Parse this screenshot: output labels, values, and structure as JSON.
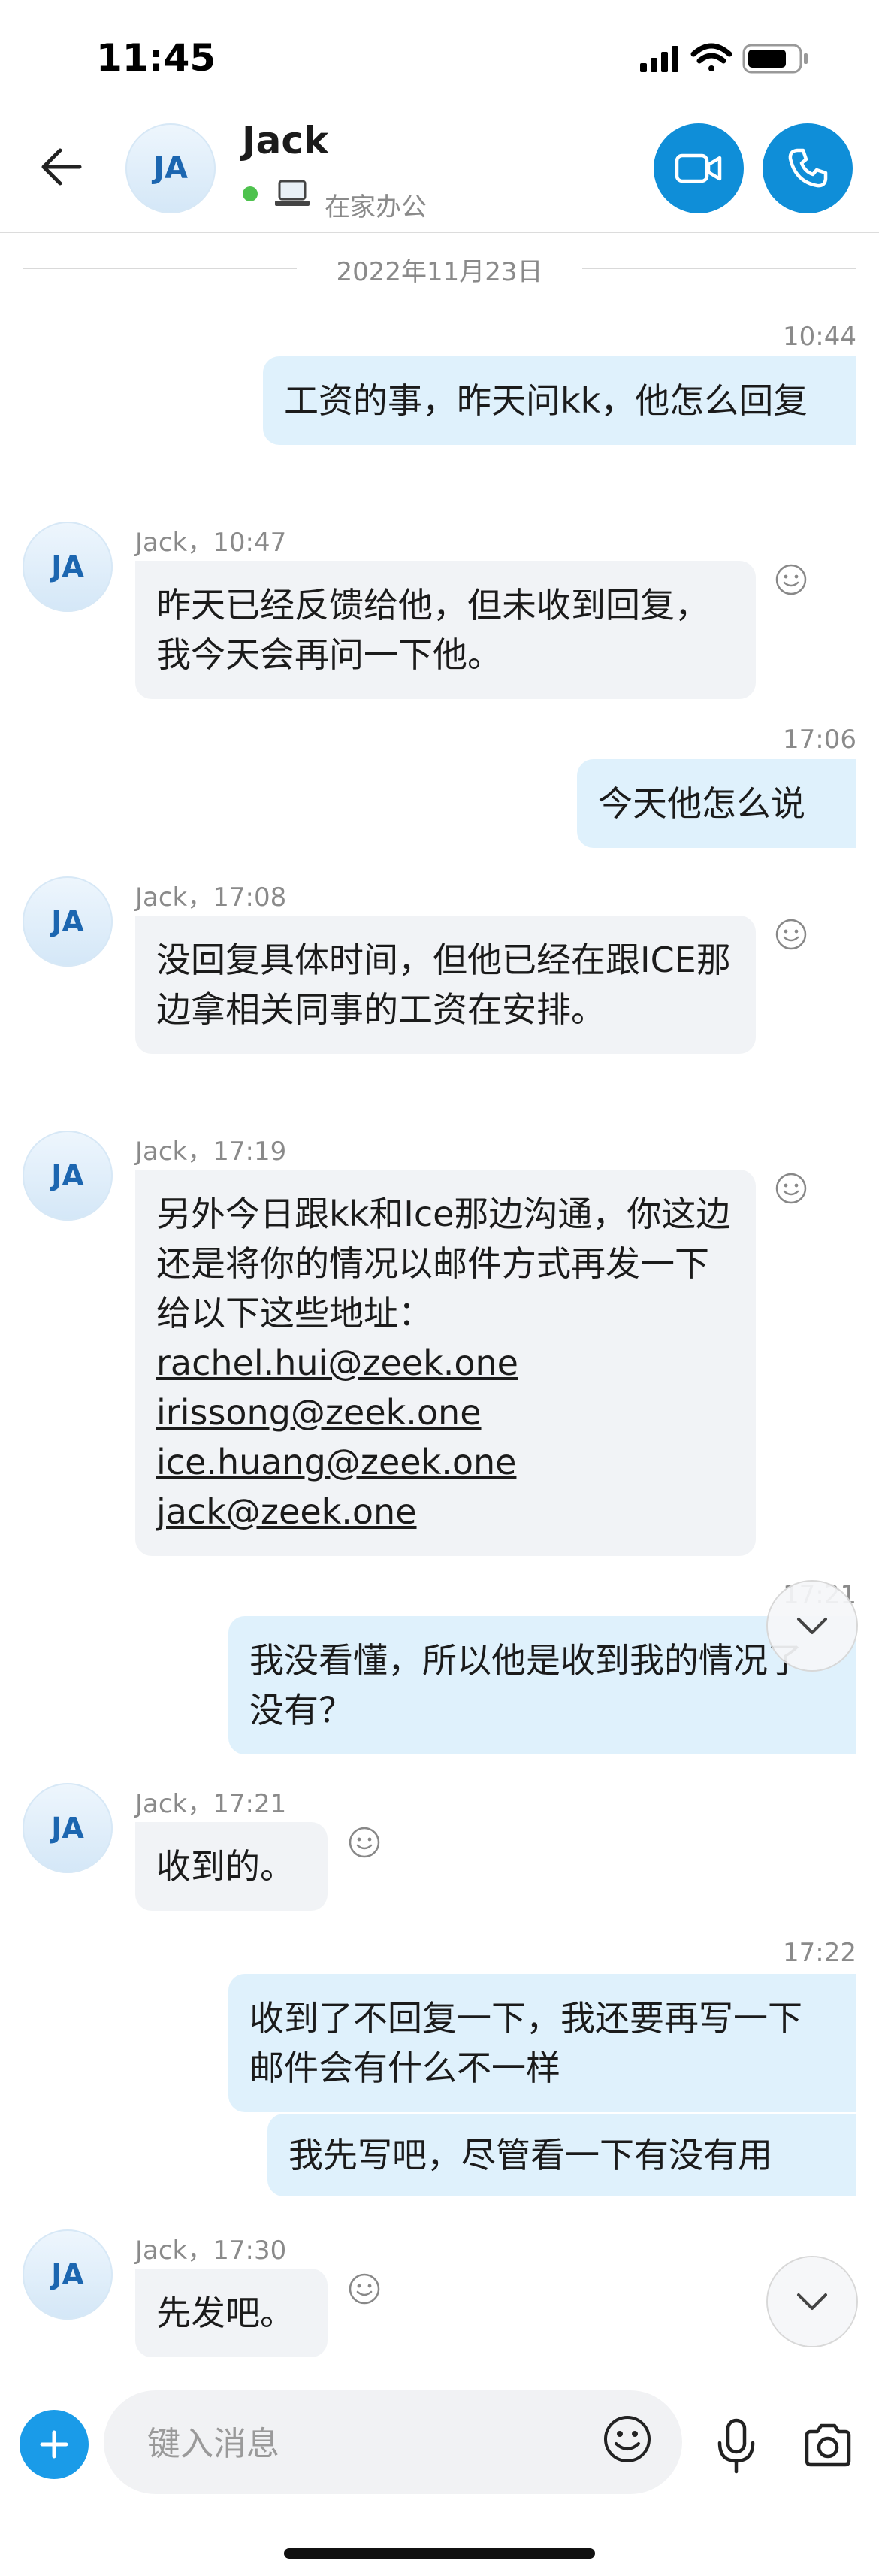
{
  "status_bar": {
    "time": "11:45"
  },
  "header": {
    "contact_name": "Jack",
    "contact_initials": "JA",
    "presence_text": "在家办公",
    "presence_color": "#4ec24e",
    "accent_color": "#0f8ed8",
    "icons": [
      "back-arrow-icon",
      "laptop-icon",
      "video-camera-icon",
      "phone-icon"
    ]
  },
  "date_divider": "2022年11月23日",
  "messages": [
    {
      "dir": "out",
      "time": "10:44",
      "text": "工资的事，昨天问kk，他怎么回复"
    },
    {
      "dir": "in",
      "meta": "Jack，10:47",
      "text": "昨天已经反馈给他，但未收到回复，我今天会再问一下他。"
    },
    {
      "dir": "out",
      "time": "17:06",
      "text": "今天他怎么说"
    },
    {
      "dir": "in",
      "meta": "Jack，17:08",
      "text": "没回复具体时间，但他已经在跟ICE那边拿相关同事的工资在安排。"
    },
    {
      "dir": "in",
      "meta": "Jack，17:19",
      "text": "另外今日跟kk和Ice那边沟通，你这边还是将你的情况以邮件方式再发一下给以下这些地址：",
      "links": [
        "rachel.hui@zeek.one",
        "irissong@zeek.one",
        "ice.huang@zeek.one",
        "jack@zeek.one"
      ]
    },
    {
      "dir": "out",
      "time": "17:21",
      "text": "我没看懂，所以他是收到我的情况了没有？"
    },
    {
      "dir": "in",
      "meta": "Jack，17:21",
      "text": "收到的。"
    },
    {
      "dir": "out",
      "time": "17:22",
      "text": "收到了不回复一下，我还要再写一下邮件会有什么不一样"
    },
    {
      "dir": "out",
      "text": "我先写吧，尽管看一下有没有用"
    },
    {
      "dir": "in",
      "meta": "Jack，17:30",
      "text": "先发吧。"
    }
  ],
  "composer": {
    "placeholder": "键入消息",
    "icons": [
      "add-icon",
      "emoji-icon",
      "microphone-icon",
      "camera-icon"
    ]
  },
  "colors": {
    "outgoing_bubble": "#dff1fc",
    "incoming_bubble": "#f1f3f6",
    "add_button": "#1a9be8"
  }
}
